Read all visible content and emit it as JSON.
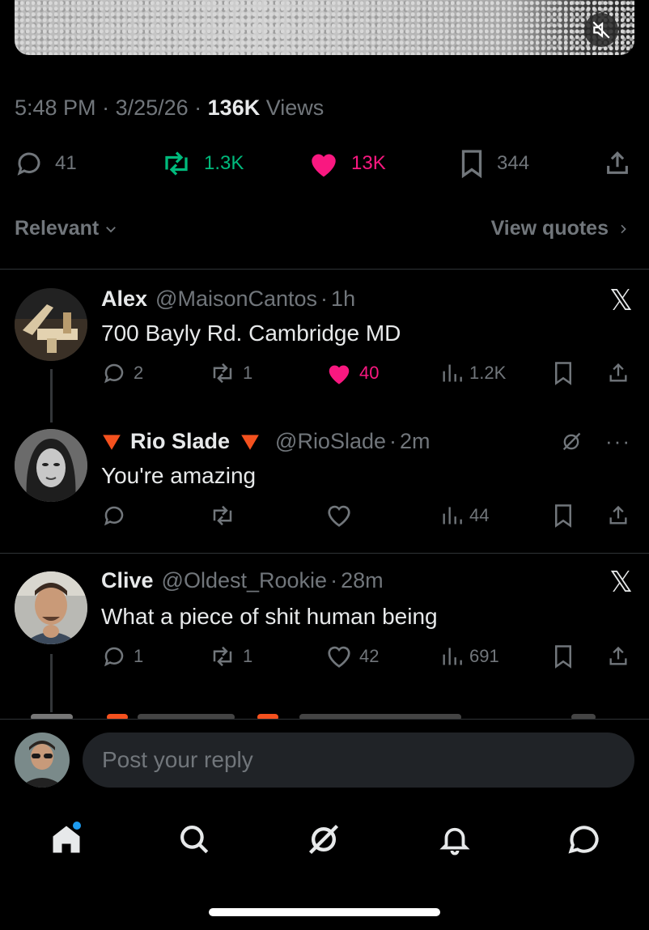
{
  "tweet": {
    "time": "5:48 PM",
    "date": "3/25/26",
    "views_count": "136K",
    "views_label": "Views",
    "stats": {
      "replies": "41",
      "reposts": "1.3K",
      "likes": "13K",
      "bookmarks": "344"
    }
  },
  "filters": {
    "sort_label": "Relevant",
    "quotes_label": "View quotes"
  },
  "replies": [
    {
      "name": "Alex",
      "handle": "@MaisonCantos",
      "time": "1h",
      "text": "700 Bayly Rd. Cambridge MD",
      "replies": "2",
      "reposts": "1",
      "likes": "40",
      "views": "1.2K",
      "liked": true
    },
    {
      "name": "Rio Slade",
      "handle": "@RioSlade",
      "time": "2m",
      "text": "You're amazing",
      "replies": "",
      "reposts": "",
      "likes": "",
      "views": "44",
      "liked": false
    },
    {
      "name": "Clive",
      "handle": "@Oldest_Rookie",
      "time": "28m",
      "text": "What a piece of shit human being",
      "replies": "1",
      "reposts": "1",
      "likes": "42",
      "views": "691",
      "liked": false
    }
  ],
  "composer": {
    "placeholder": "Post your reply"
  },
  "colors": {
    "background": "#000000",
    "muted": "#71767b",
    "text": "#e7e9ea",
    "repost_green": "#00ba7c",
    "like_pink": "#f91880",
    "accent_blue": "#1d9bf0",
    "divider": "#2f3336",
    "red_triangle": "#f4511e"
  }
}
